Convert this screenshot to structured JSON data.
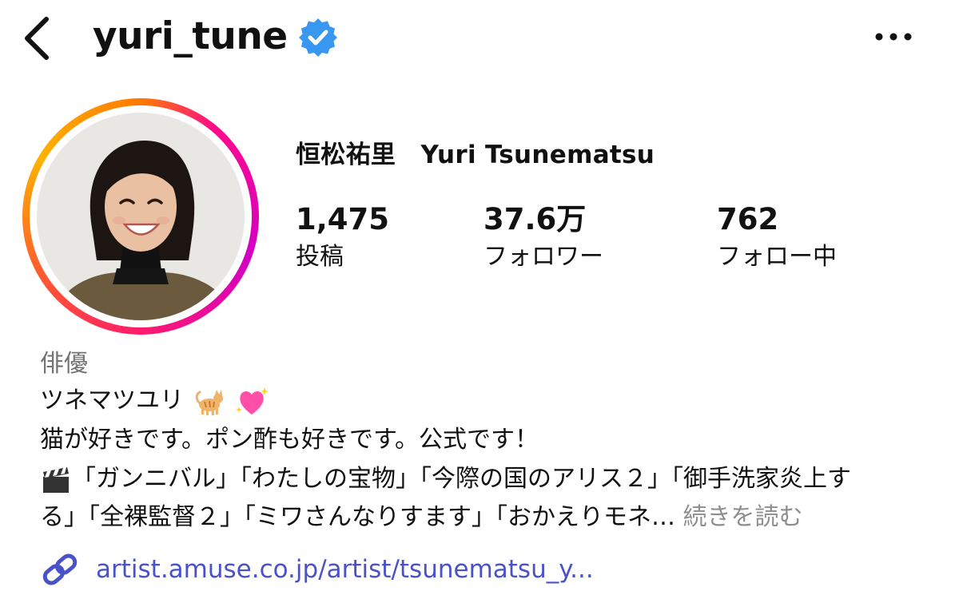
{
  "header": {
    "username": "yuri_tune"
  },
  "profile": {
    "full_name": "恒松祐里　Yuri Tsunematsu",
    "stats": {
      "posts_count": "1,475",
      "posts_label": "投稿",
      "followers_count": "37.6万",
      "followers_label": "フォロワー",
      "following_count": "762",
      "following_label": "フォロー中"
    },
    "category": "俳優",
    "bio": {
      "line1": "ツネマツユリ",
      "line1_emojis": [
        "cat-emoji",
        "sparkling-heart-emoji"
      ],
      "line2": "猫が好きです。ポン酢も好きです。公式です！",
      "line3_emoji": "clapper-board-emoji",
      "line3": "「ガンニバル」「わたしの宝物」「今際の国のアリス２」「御手洗家炎上す",
      "line4": "る」「全裸監督２」「ミワさんなりすます」「おかえりモネ…",
      "more_label": "続きを読む"
    },
    "link": "artist.amuse.co.jp/artist/tsunematsu_y..."
  },
  "colors": {
    "verified_badge": "#3897f0",
    "link": "#4a52c8",
    "secondary_text": "#737373",
    "story_ring_start": "#ff0a8c",
    "story_ring_end": "#ffb200"
  }
}
